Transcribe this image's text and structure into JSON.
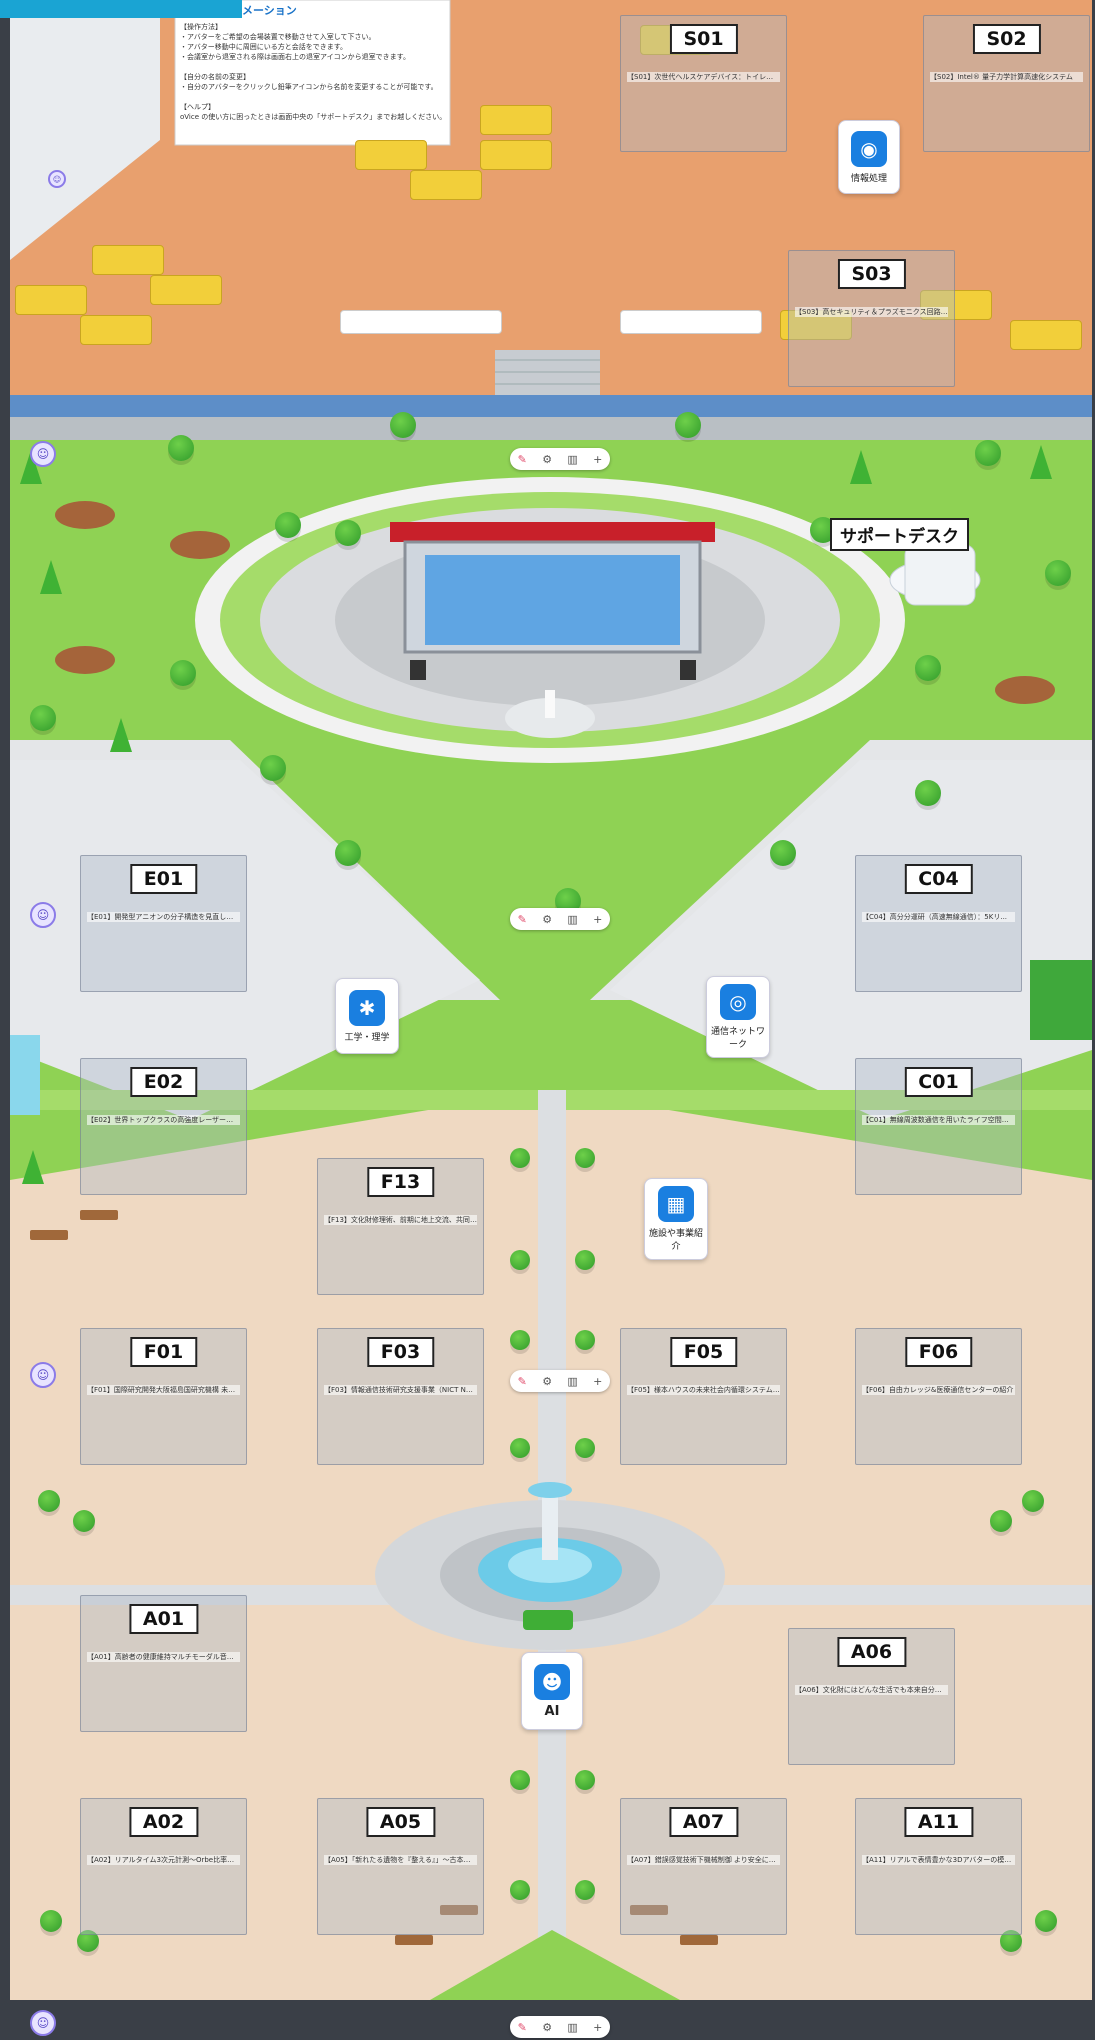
{
  "header": {
    "title_tab": "メーション",
    "brand_color": "#1aa4d3"
  },
  "info_box": {
    "lines": [
      "【操作方法】",
      "・アバターをご希望の会場装置で移動させて入室して下さい。",
      "・アバター移動中に周囲にいる方と会話をできます。",
      "・会議室から退室される際は画面右上の退室アイコンから退室できます。",
      "",
      "【自分の名前の変更】",
      "・自分のアバターをクリックし鉛筆アイコンから名前を変更することが可能です。",
      "",
      "【ヘルプ】",
      "oVice の使い方に困ったときは画面中央の「サポートデスク」までお越しください。"
    ]
  },
  "booths": [
    {
      "id": "S01",
      "desc": "【S01】次世代ヘルスケアデバイス：トイレで健康..."
    },
    {
      "id": "S02",
      "desc": "【S02】Intel® 量子力学計算高速化システム"
    },
    {
      "id": "S03",
      "desc": "【S03】高セキュリティ＆プラズモニクス回路の..."
    },
    {
      "id": "E01",
      "desc": "【E01】開発型アニオンの分子構造を見直した新..."
    },
    {
      "id": "E02",
      "desc": "【E02】世界トップクラスの高強度レーザー開発と..."
    },
    {
      "id": "C04",
      "desc": "【C04】高分分運研（高速無線通信）：5Kリ..."
    },
    {
      "id": "C01",
      "desc": "【C01】無線周波数通信を用いたライフ空間見え..."
    },
    {
      "id": "F13",
      "desc": "【F13】文化財修理術、前期に地上交流、共同研究..."
    },
    {
      "id": "F01",
      "desc": "【F01】国際研究開発大阪福島国研究機構 未来に..."
    },
    {
      "id": "F03",
      "desc": "【F03】情報通信技術研究支援事業（NICT Net紹介）"
    },
    {
      "id": "F05",
      "desc": "【F05】様本ハウスの未来社会内循環システム「S..."
    },
    {
      "id": "F06",
      "desc": "【F06】自由カレッジ&医療通信センターの紹介"
    },
    {
      "id": "A01",
      "desc": "【A01】高齢者の健康維持マルチモーダル音声 対話..."
    },
    {
      "id": "A06",
      "desc": "【A06】文化財にはどんな生活でも本来自分に..."
    },
    {
      "id": "A02",
      "desc": "【A02】リアルタイム3次元計測～Orbe比率ステ..."
    },
    {
      "id": "A05",
      "desc": "【A05】「新れたる遺物を『整える』」～古本品..."
    },
    {
      "id": "A07",
      "desc": "【A07】錯誤感覚技術下機械制御 より安全に活用..."
    },
    {
      "id": "A11",
      "desc": "【A11】リアルで表情豊かな3Dアバターの模擬..."
    }
  ],
  "categories": {
    "info": "情報処理",
    "engineering": "工学・理学",
    "network": "通信ネットワーク",
    "facility": "施設や事業紹介",
    "ai": "AI"
  },
  "landmarks": {
    "support_desk": "サポートデスク"
  },
  "toolbar": {
    "icons": [
      "mic-off-icon",
      "settings-icon",
      "map-icon",
      "plus-icon"
    ]
  },
  "colors": {
    "grass": "#8ed253",
    "plaza": "#cfd3d6",
    "floor_top": "#e7a06f",
    "water": "#8ad7ec"
  }
}
